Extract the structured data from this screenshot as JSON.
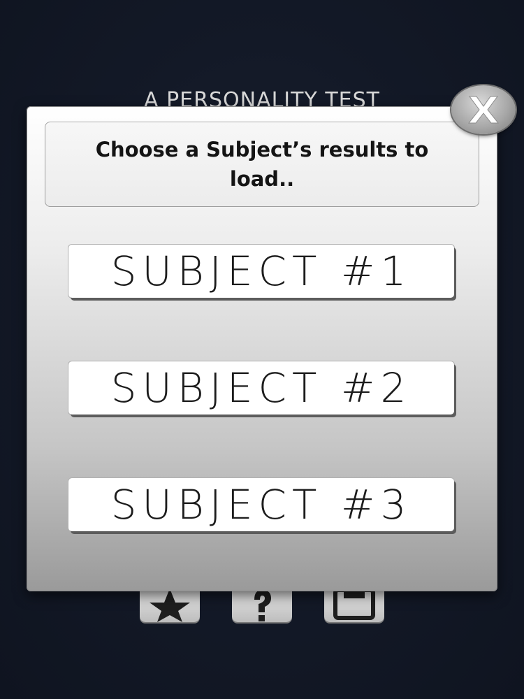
{
  "background": {
    "title": "A PERSONALITY TEST"
  },
  "dialog": {
    "prompt": "Choose a Subject’s results to load..",
    "subjects": [
      {
        "label": "SUBJECT #1"
      },
      {
        "label": "SUBJECT #2"
      },
      {
        "label": "SUBJECT #3"
      }
    ]
  },
  "icons": {
    "close": "close-icon",
    "bottom": [
      "star-icon",
      "help-icon",
      "save-icon"
    ]
  },
  "colors": {
    "background": "#121826",
    "dialog_top": "#ffffff",
    "dialog_bottom": "#9a9a9a",
    "button_face": "#ffffff",
    "text": "#141414"
  }
}
